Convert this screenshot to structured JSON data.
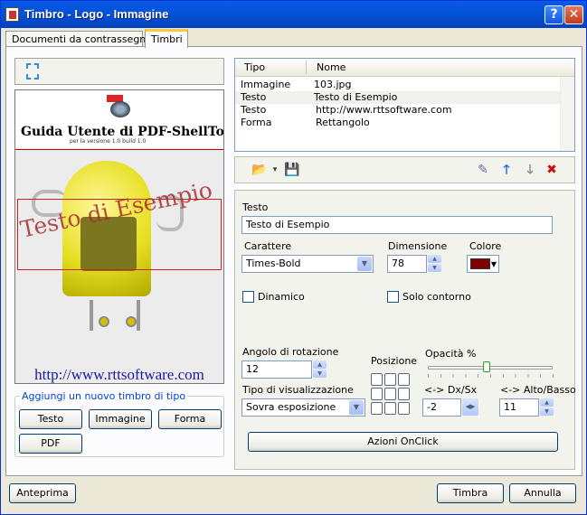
{
  "window": {
    "title": "Timbro - Logo - Immagine",
    "help": "?",
    "close": "✕"
  },
  "tabs": [
    "Documenti da contrassegnare",
    "Timbri"
  ],
  "preview": {
    "doc_title": "Guida Utente di PDF-ShellTools",
    "doc_subtitle": "per la versione 1.0 build 1.0",
    "stamp_text": "Testo di Esempio",
    "url": "http://www.rttsoftware.com"
  },
  "add_group": {
    "legend": "Aggiungi un nuovo timbro di tipo",
    "buttons": [
      "Testo",
      "Immagine",
      "Forma",
      "PDF"
    ]
  },
  "list": {
    "columns": [
      "Tipo",
      "Nome"
    ],
    "rows": [
      {
        "tipo": "Immagine",
        "nome": "103.jpg"
      },
      {
        "tipo": "Testo",
        "nome": "Testo di Esempio"
      },
      {
        "tipo": "Testo",
        "nome": "http://www.rttsoftware.com"
      },
      {
        "tipo": "Forma",
        "nome": "Rettangolo"
      }
    ]
  },
  "toolbar": {
    "icons": [
      "open-folder-icon",
      "save-icon",
      "wizard-icon",
      "arrow-up-icon",
      "arrow-down-icon",
      "delete-icon"
    ]
  },
  "props": {
    "testo_label": "Testo",
    "testo_value": "Testo di Esempio",
    "carattere_label": "Carattere",
    "carattere_value": "Times-Bold",
    "dimensione_label": "Dimensione",
    "dimensione_value": "78",
    "colore_label": "Colore",
    "colore_value": "#800000",
    "dinamico_label": "Dinamico",
    "solo_contorno_label": "Solo contorno",
    "angolo_label": "Angolo di rotazione",
    "angolo_value": "12",
    "posizione_label": "Posizione",
    "opacita_label": "Opacità %",
    "opacita_value_fraction": 0.47,
    "tipo_vis_label": "Tipo di visualizzazione",
    "tipo_vis_value": "Sovra esposizione",
    "dxsx_label": "<-> Dx/Sx",
    "dxsx_value": "-2",
    "altobasso_label": "<-> Alto/Basso",
    "altobasso_value": "11",
    "azioni_button": "Azioni OnClick"
  },
  "footer": {
    "preview_button": "Anteprima",
    "stamp_button": "Timbra",
    "cancel_button": "Annulla"
  }
}
